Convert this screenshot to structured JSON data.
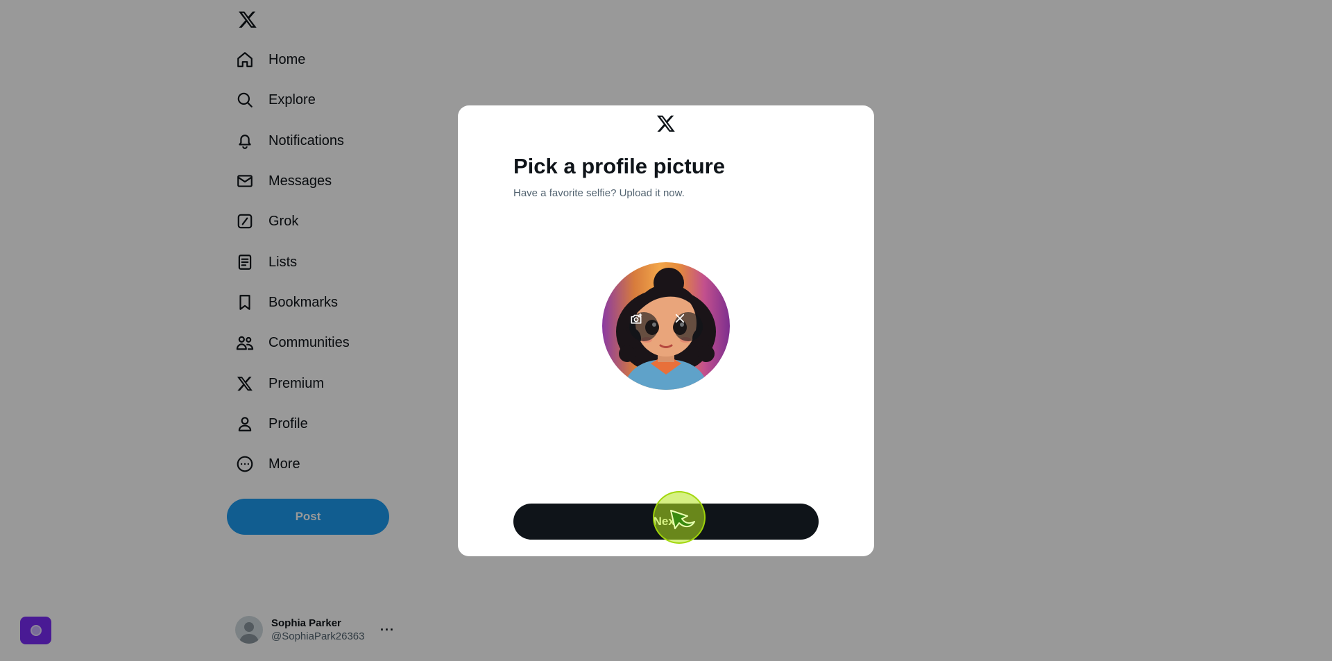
{
  "sidebar": {
    "logo_icon": "x-logo-icon",
    "items": [
      {
        "label": "Home",
        "icon": "home-icon"
      },
      {
        "label": "Explore",
        "icon": "search-icon"
      },
      {
        "label": "Notifications",
        "icon": "bell-icon"
      },
      {
        "label": "Messages",
        "icon": "envelope-icon"
      },
      {
        "label": "Grok",
        "icon": "grok-icon"
      },
      {
        "label": "Lists",
        "icon": "list-icon"
      },
      {
        "label": "Bookmarks",
        "icon": "bookmark-icon"
      },
      {
        "label": "Communities",
        "icon": "communities-icon"
      },
      {
        "label": "Premium",
        "icon": "x-logo-icon"
      },
      {
        "label": "Profile",
        "icon": "person-icon"
      },
      {
        "label": "More",
        "icon": "more-circle-icon"
      }
    ],
    "post_label": "Post"
  },
  "account": {
    "name": "Sophia Parker",
    "handle": "@SophiaPark26363",
    "more": "···"
  },
  "modal": {
    "title": "Pick a profile picture",
    "subtitle": "Have a favorite selfie? Upload it now.",
    "next_label": "Next"
  },
  "colors": {
    "post_button": "#1d9bf0",
    "next_button": "#0f1419",
    "extension_badge": "#7b2cf7",
    "cursor_highlight": "#b4e61e"
  }
}
